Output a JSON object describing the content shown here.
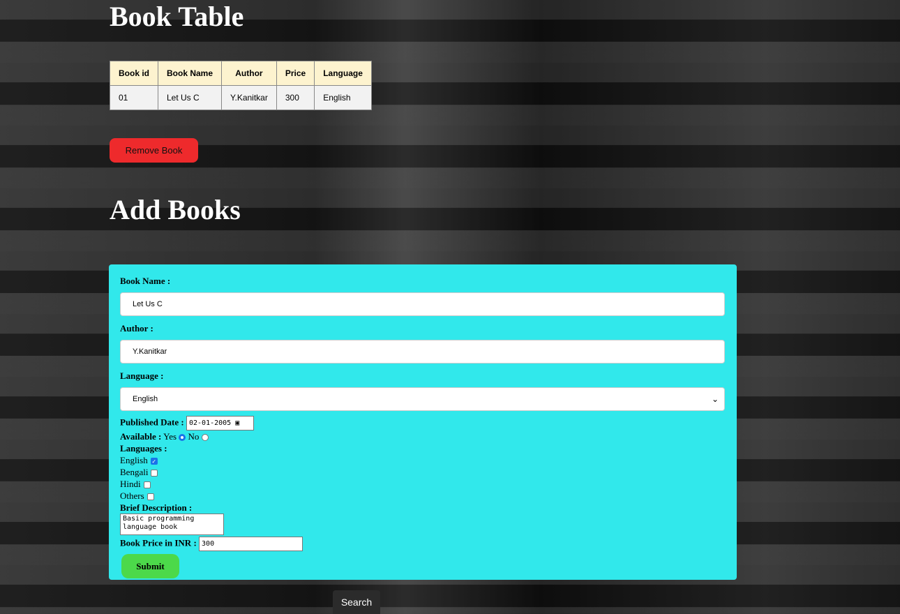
{
  "book_table": {
    "title": "Book Table",
    "headers": [
      "Book id",
      "Book Name",
      "Author",
      "Price",
      "Language"
    ],
    "rows": [
      [
        "01",
        "Let Us C",
        "Y.Kanitkar",
        "300",
        "English"
      ]
    ],
    "remove_label": "Remove Book"
  },
  "add_books": {
    "title": "Add Books",
    "book_name_label": "Book Name :",
    "book_name_value": "Let Us C",
    "author_label": "Author :",
    "author_value": "Y.Kanitkar",
    "language_label": "Language :",
    "language_value": "English",
    "published_label": "Published Date :",
    "published_value": "02-01-2005",
    "available_label": "Available :",
    "yes_label": "Yes",
    "no_label": "No",
    "languages_label": "Languages :",
    "languages": [
      {
        "label": "English",
        "checked": true
      },
      {
        "label": "Bengali",
        "checked": false
      },
      {
        "label": "Hindi",
        "checked": false
      },
      {
        "label": "Others",
        "checked": false
      }
    ],
    "description_label": "Brief Description :",
    "description_value": "Basic programming language book",
    "price_label": "Book Price in INR :",
    "price_value": "300",
    "submit_label": "Submit"
  },
  "search_label": "Search"
}
